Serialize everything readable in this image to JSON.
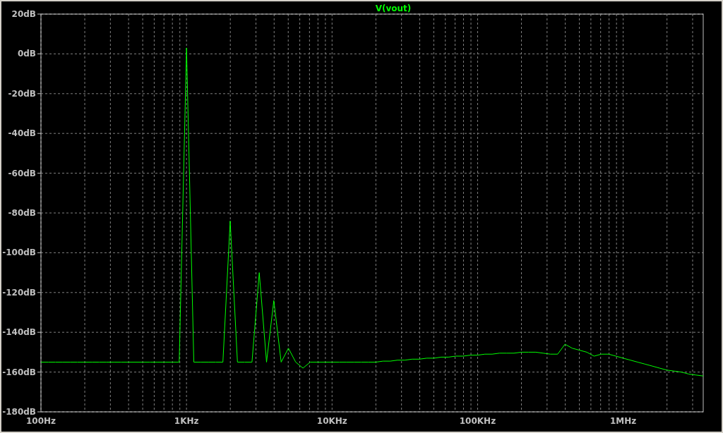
{
  "plot": {
    "chart_data": {
      "type": "line",
      "grid": true,
      "categories": [
        "100Hz",
        null,
        null,
        null,
        null,
        null,
        null,
        null,
        null,
        null,
        null,
        null,
        null,
        null,
        null,
        null,
        null,
        null,
        null,
        null,
        "1KHz",
        null,
        null,
        null,
        null,
        null,
        null,
        null,
        null,
        null,
        null,
        null,
        null,
        null,
        null,
        null,
        null,
        null,
        null,
        null,
        "10KHz",
        null,
        null,
        null,
        null,
        null,
        null,
        null,
        null,
        null,
        null,
        null,
        null,
        null,
        null,
        null,
        null,
        null,
        null,
        null,
        "100KHz",
        null,
        null,
        null,
        null,
        null,
        null,
        null,
        null,
        null,
        null,
        null,
        null,
        null,
        null,
        null,
        null,
        null,
        null,
        null,
        "1MHz",
        null,
        null,
        null,
        null,
        null,
        null,
        null,
        null,
        null,
        null,
        null
      ],
      "series": [
        {
          "name": "V(vout)",
          "color": "#00ff00",
          "values": [
            -155,
            -155,
            -155,
            -155,
            -155,
            -155,
            -155,
            -155,
            -155,
            -155,
            -155,
            -155,
            -155,
            -155,
            -155,
            -155,
            -155,
            -155,
            -155,
            -155,
            3,
            -155,
            -155,
            -155,
            -155,
            -155,
            -84,
            -155,
            -155,
            -155,
            -110,
            -155,
            -124,
            -155,
            -148,
            -155,
            -158,
            -155,
            -155,
            -155,
            -155,
            -155,
            -155,
            -155,
            -155,
            -155,
            -155,
            -154.5,
            -154.5,
            -154,
            -154,
            -153.5,
            -153.5,
            -153,
            -153,
            -152.5,
            -152.5,
            -152,
            -152,
            -151.5,
            -151.5,
            -151,
            -151,
            -150.5,
            -150.5,
            -150.5,
            -150,
            -150,
            -150,
            -150.5,
            -151,
            -151,
            -146,
            -148,
            -149,
            -150,
            -152,
            -151,
            -151,
            -152,
            -153,
            -154,
            -155,
            -156,
            -157,
            -158,
            -159,
            -159.5,
            -160,
            -161,
            -161.5,
            -162
          ]
        }
      ],
      "ylim": [
        -180,
        20
      ],
      "yticks": [
        {
          "value": 20,
          "label": "20dB"
        },
        {
          "value": 0,
          "label": "0dB"
        },
        {
          "value": -20,
          "label": "-20dB"
        },
        {
          "value": -40,
          "label": "-40dB"
        },
        {
          "value": -60,
          "label": "-60dB"
        },
        {
          "value": -80,
          "label": "-80dB"
        },
        {
          "value": -100,
          "label": "-100dB"
        },
        {
          "value": -120,
          "label": "-120dB"
        },
        {
          "value": -140,
          "label": "-140dB"
        },
        {
          "value": -160,
          "label": "-160dB"
        },
        {
          "value": -180,
          "label": "-180dB"
        }
      ]
    }
  }
}
